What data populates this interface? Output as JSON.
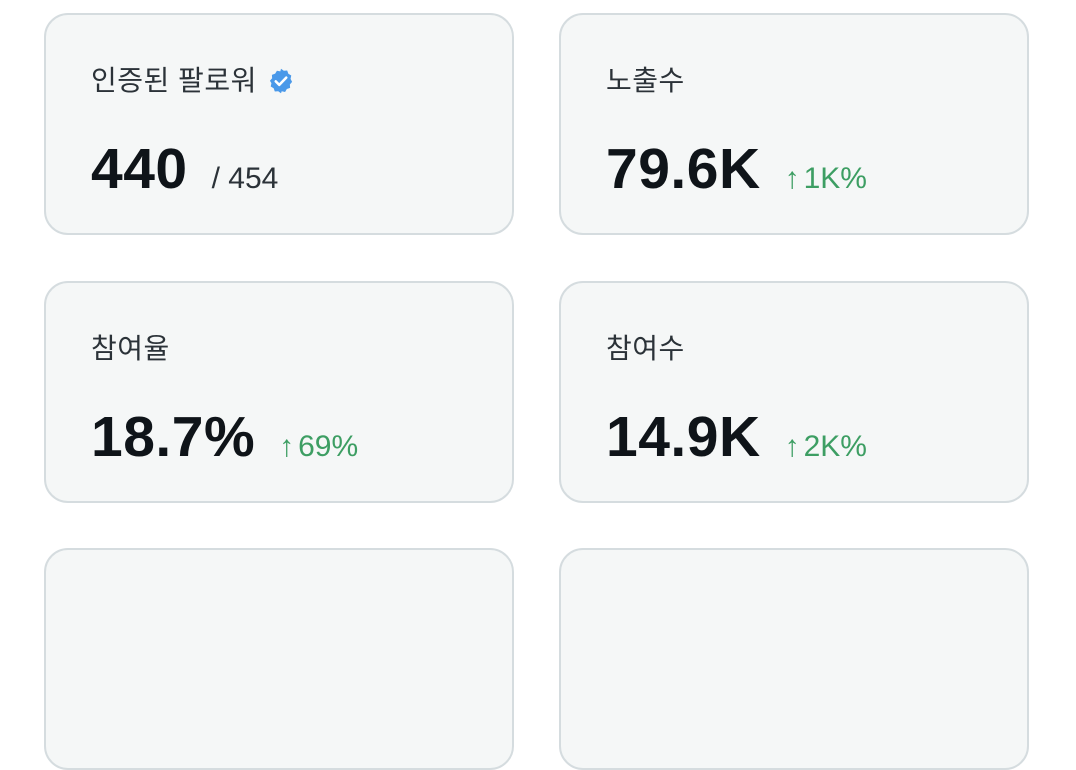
{
  "cards": [
    {
      "label": "인증된 팔로워",
      "value": "440",
      "sub": "/ 454",
      "verified": true
    },
    {
      "label": "노출수",
      "value": "79.6K",
      "delta": "1K%"
    },
    {
      "label": "참여율",
      "value": "18.7%",
      "delta": "69%"
    },
    {
      "label": "참여수",
      "value": "14.9K",
      "delta": "2K%"
    }
  ],
  "arrow": "↑",
  "colors": {
    "card_bg": "#f5f7f7",
    "card_border": "#d5dcdf",
    "value": "#0f1419",
    "positive": "#3d9e63",
    "verified": "#4a99e9"
  },
  "icons": {
    "verified": "verified-badge-icon",
    "delta": "arrow-up-icon"
  }
}
